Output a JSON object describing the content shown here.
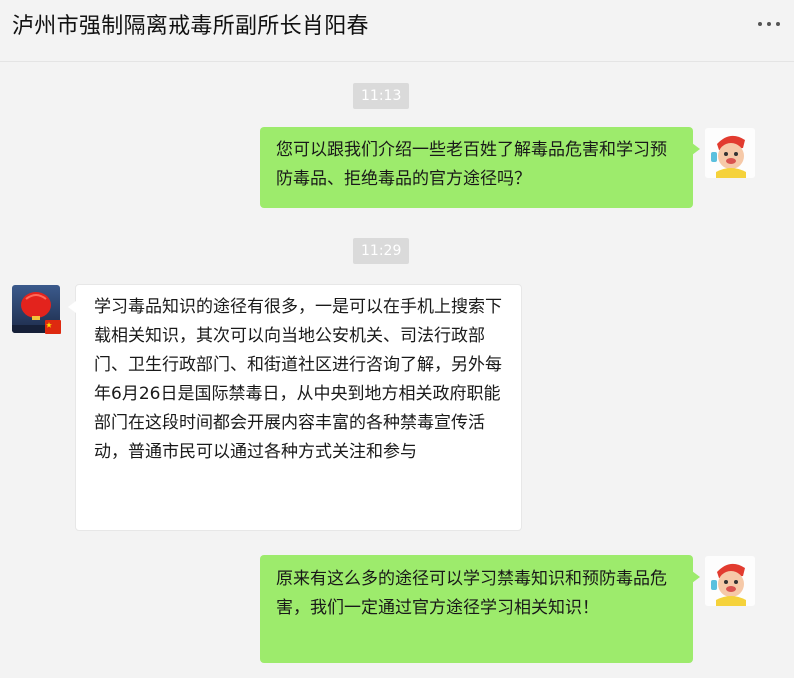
{
  "header": {
    "title": "泸州市强制隔离戒毒所副所长肖阳春"
  },
  "messages": [
    {
      "type": "time",
      "text": "11:13"
    },
    {
      "type": "text",
      "direction": "out",
      "text": "您可以跟我们介绍一些老百姓了解毒品危害和学习预防毒品、拒绝毒品的官方途径吗？"
    },
    {
      "type": "time",
      "text": "11:29"
    },
    {
      "type": "text",
      "direction": "in",
      "text": "学习毒品知识的途径有很多，一是可以在手机上搜索下载相关知识，其次可以向当地公安机关、司法行政部门、卫生行政部门、和街道社区进行咨询了解，另外每年6月26日是国际禁毒日，从中央到地方相关政府职能部门在这段时间都会开展内容丰富的各种禁毒宣传活动，普通市民可以通过各种方式关注和参与"
    },
    {
      "type": "text",
      "direction": "out",
      "text": "原来有这么多的途径可以学习禁毒知识和预防毒品危害，我们一定通过官方途径学习相关知识！"
    }
  ],
  "colors": {
    "outgoing_bubble": "#9deb6c",
    "incoming_bubble": "#ffffff",
    "background": "#f3f3f3",
    "timestamp_bg": "#dadada"
  },
  "icons": {
    "more": "more-dots-icon",
    "user_avatar": "cartoon-avatar",
    "official_avatar": "red-lantern-avatar",
    "flag": "china-flag-icon"
  }
}
